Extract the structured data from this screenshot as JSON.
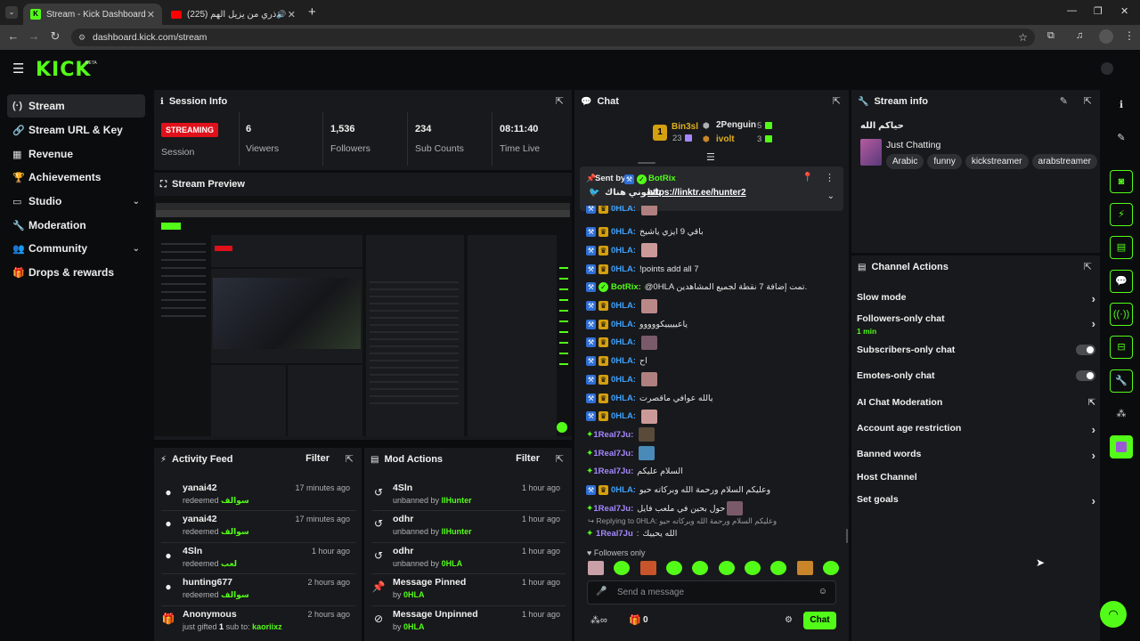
{
  "browser": {
    "tabs": [
      {
        "title": "Stream - Kick Dashboard"
      },
      {
        "title": "(225) أذري من يزيل الهم || ..."
      }
    ],
    "url": "dashboard.kick.com/stream",
    "new_tab_label": "+"
  },
  "site": {
    "logo": "KICK",
    "beta": "BETA"
  },
  "sidebar": {
    "items": [
      {
        "label": "Stream",
        "icon": "stream-icon"
      },
      {
        "label": "Stream URL & Key",
        "icon": "link-icon"
      },
      {
        "label": "Revenue",
        "icon": "revenue-icon"
      },
      {
        "label": "Achievements",
        "icon": "trophy-icon"
      },
      {
        "label": "Studio",
        "icon": "studio-icon"
      },
      {
        "label": "Moderation",
        "icon": "wrench-icon"
      },
      {
        "label": "Community",
        "icon": "community-icon"
      },
      {
        "label": "Drops & rewards",
        "icon": "gift-icon"
      }
    ]
  },
  "session": {
    "title": "Session Info",
    "status": "STREAMING",
    "status_label": "Session",
    "stats": [
      {
        "value": "6",
        "label": "Viewers"
      },
      {
        "value": "1,536",
        "label": "Followers"
      },
      {
        "value": "234",
        "label": "Sub Counts"
      },
      {
        "value": "08:11:40",
        "label": "Time Live"
      }
    ]
  },
  "preview": {
    "title": "Stream Preview"
  },
  "activity": {
    "title": "Activity Feed",
    "filter": "Filter",
    "items": [
      {
        "name": "yanai42",
        "action": "redeemed",
        "reward": "سوالف",
        "time": "17 minutes ago"
      },
      {
        "name": "yanai42",
        "action": "redeemed",
        "reward": "سوالف",
        "time": "17 minutes ago"
      },
      {
        "name": "4Sln",
        "action": "redeemed",
        "reward": "لعب",
        "time": "1 hour ago"
      },
      {
        "name": "hunting677",
        "action": "redeemed",
        "reward": "سوالف",
        "time": "2 hours ago"
      },
      {
        "name": "Anonymous",
        "action": "just gifted",
        "reward": "1",
        "extra": "sub to:",
        "target": "kaoriixz",
        "time": "2 hours ago"
      }
    ]
  },
  "modactions": {
    "title": "Mod Actions",
    "filter": "Filter",
    "items": [
      {
        "name": "4Sln",
        "action": "unbanned by",
        "by": "IIHunter",
        "time": "1 hour ago"
      },
      {
        "name": "odhr",
        "action": "unbanned by",
        "by": "IIHunter",
        "time": "1 hour ago"
      },
      {
        "name": "odhr",
        "action": "unbanned by",
        "by": "0HLA",
        "time": "1 hour ago"
      },
      {
        "name": "Message Pinned",
        "action": "by",
        "by": "0HLA",
        "time": "1 hour ago"
      },
      {
        "name": "Message Unpinned",
        "action": "by",
        "by": "0HLA",
        "time": "1 hour ago"
      }
    ]
  },
  "chat": {
    "title": "Chat",
    "leaderboard": [
      {
        "name": "Bin3sl",
        "value": "23",
        "rank": "1"
      },
      {
        "name": "2Penguin",
        "value": "5"
      },
      {
        "name": "ivolt",
        "value": "3"
      }
    ],
    "pinned": {
      "sent_by": "Sent by",
      "user": "BotRix",
      "text": "تابعوني هناك",
      "link": "https://linktr.ee/hunter2"
    },
    "messages": [
      {
        "user": "0HLA",
        "text": "",
        "emote": true,
        "partial": true
      },
      {
        "user": "0HLA",
        "text": "باقي 9 ايزي ياشيخ",
        "emote": false
      },
      {
        "user": "0HLA",
        "text": "",
        "emote": true
      },
      {
        "user": "0HLA",
        "text": "!points add all 7",
        "emote": false
      },
      {
        "user": "BotRix",
        "text": "@0HLA تمت إضافة 7 نقطة لجميع المشاهدين.",
        "emote": false,
        "bot": true
      },
      {
        "user": "0HLA",
        "text": "",
        "emote": true
      },
      {
        "user": "0HLA",
        "text": "ياعيييييكووووو",
        "emote": false
      },
      {
        "user": "0HLA",
        "text": "",
        "emote": true
      },
      {
        "user": "0HLA",
        "text": "اح",
        "emote": false
      },
      {
        "user": "0HLA",
        "text": "",
        "emote": true
      },
      {
        "user": "0HLA",
        "text": "يالله عوافي ماقصرت",
        "emote": false
      },
      {
        "user": "0HLA",
        "text": "",
        "emote": true
      },
      {
        "user": "1Real7Ju",
        "text": "",
        "emote": true,
        "gift": true
      },
      {
        "user": "1Real7Ju",
        "text": "",
        "emote": true,
        "gift": true
      },
      {
        "user": "1Real7Ju",
        "text": "السلام عليكم",
        "emote": false,
        "gift": true
      },
      {
        "user": "0HLA",
        "text": "وعليكم السلام ورحمة الله وبركاته حيو",
        "emote": false
      },
      {
        "user": "1Real7Ju",
        "text": "حول بحين في ملعب فايل",
        "emote": true,
        "gift": true
      }
    ],
    "reply_label": "Replying to 0HLA: وعليكم السلام ورحمة الله وبركاته حيو",
    "reply_user": "1Real7Ju",
    "reply_text": "الله يحييك",
    "followers_only": "Followers only",
    "input_placeholder": "Send a message",
    "points": "0",
    "send_label": "Chat"
  },
  "streaminfo": {
    "title": "Stream info",
    "stream_title": "حياكم الله",
    "category": "Just Chatting",
    "tags": [
      "Arabic",
      "funny",
      "kickstreamer",
      "arabstreamer"
    ]
  },
  "channel_actions": {
    "title": "Channel Actions",
    "items": [
      {
        "label": "Slow mode",
        "control": "chevron"
      },
      {
        "label": "Followers-only chat",
        "sub": "1 min",
        "control": "chevron"
      },
      {
        "label": "Subscribers-only chat",
        "control": "toggle"
      },
      {
        "label": "Emotes-only chat",
        "control": "toggle"
      },
      {
        "label": "AI Chat Moderation",
        "control": "external"
      },
      {
        "label": "Account age restriction",
        "control": "chevron"
      },
      {
        "label": "Banned words",
        "control": "chevron"
      },
      {
        "label": "Host Channel",
        "control": "none"
      },
      {
        "label": "Set goals",
        "control": "chevron"
      }
    ]
  },
  "colors": {
    "accent": "#53fc18",
    "background": "#0b0c0e",
    "panel": "#18191c",
    "streaming": "#e0111b"
  }
}
